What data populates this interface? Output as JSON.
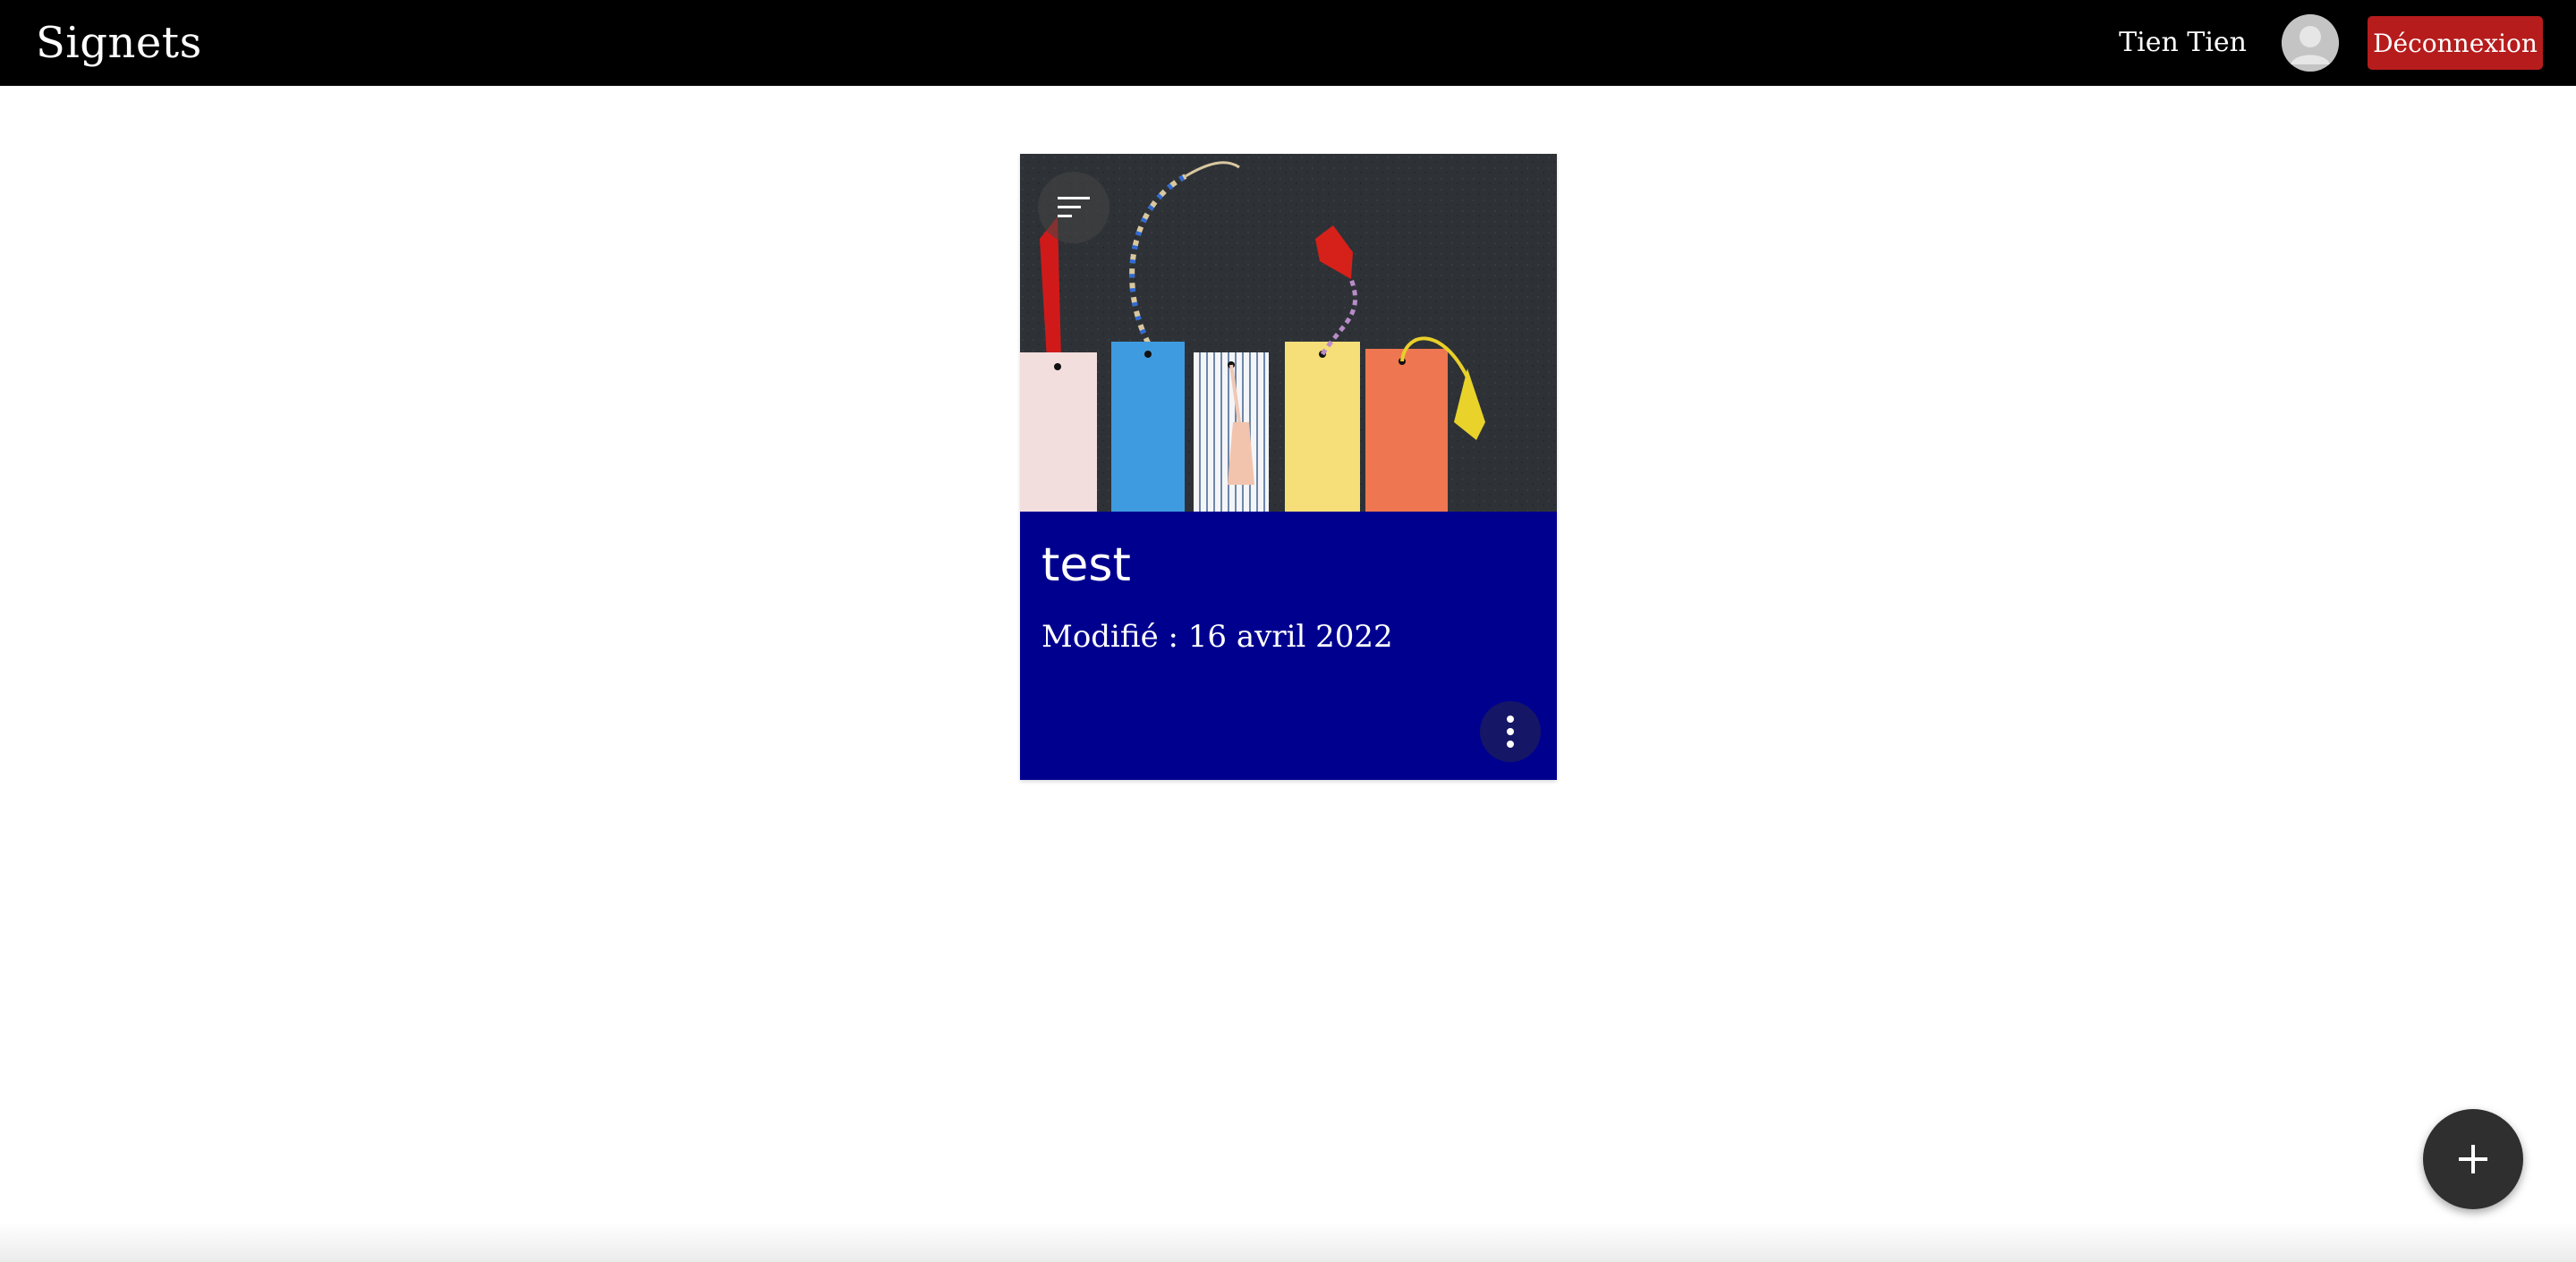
{
  "header": {
    "title": "Signets",
    "user_name": "Tien Tien",
    "logout_label": "Déconnexion"
  },
  "cards": [
    {
      "title": "test",
      "modified": "Modifié : 16 avril 2022"
    }
  ],
  "icons": {
    "sort": "sort-icon",
    "menu": "more-vert-icon",
    "add": "plus-icon",
    "avatar": "person-avatar-icon"
  },
  "colors": {
    "appbar": "#000000",
    "logout": "#b71c1c",
    "card_background": "#00008f",
    "fab": "#2f2f2f"
  }
}
